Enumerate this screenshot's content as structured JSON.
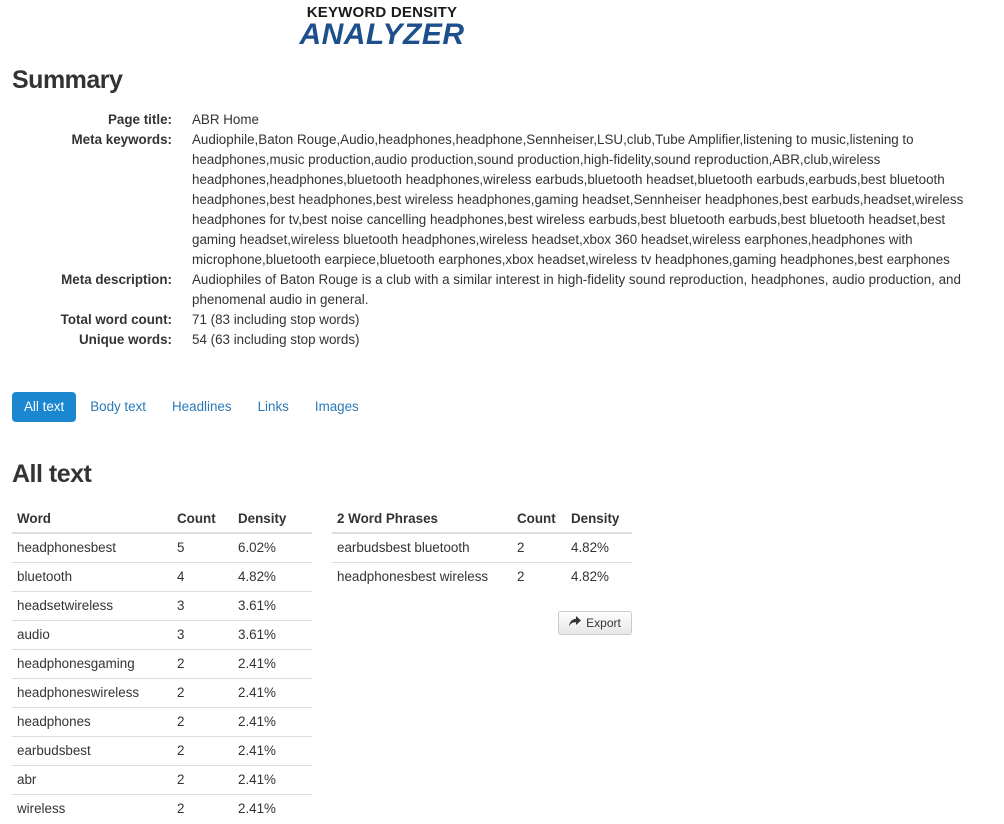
{
  "logo": {
    "line1": "KEYWORD DENSITY",
    "line2": "ANALYZER",
    "color": "#1d4f8c"
  },
  "summary": {
    "heading": "Summary",
    "rows": [
      {
        "label": "Page title:",
        "value": "ABR Home"
      },
      {
        "label": "Meta keywords:",
        "value": "Audiophile,Baton Rouge,Audio,headphones,headphone,Sennheiser,LSU,club,Tube Amplifier,listening to music,listening to headphones,music production,audio production,sound production,high-fidelity,sound reproduction,ABR,club,wireless headphones,headphones,bluetooth headphones,wireless earbuds,bluetooth headset,bluetooth earbuds,earbuds,best bluetooth headphones,best headphones,best wireless headphones,gaming headset,Sennheiser headphones,best earbuds,headset,wireless headphones for tv,best noise cancelling headphones,best wireless earbuds,best bluetooth earbuds,best bluetooth headset,best gaming headset,wireless bluetooth headphones,wireless headset,xbox 360 headset,wireless earphones,headphones with microphone,bluetooth earpiece,bluetooth earphones,xbox headset,wireless tv headphones,gaming headphones,best earphones"
      },
      {
        "label": "Meta description:",
        "value": "Audiophiles of Baton Rouge is a club with a similar interest in high-fidelity sound reproduction, headphones, audio production, and phenomenal audio in general."
      },
      {
        "label": "Total word count:",
        "value": "71 (83 including stop words)"
      },
      {
        "label": "Unique words:",
        "value": "54 (63 including stop words)"
      }
    ]
  },
  "tabs": [
    {
      "label": "All text",
      "active": true
    },
    {
      "label": "Body text",
      "active": false
    },
    {
      "label": "Headlines",
      "active": false
    },
    {
      "label": "Links",
      "active": false
    },
    {
      "label": "Images",
      "active": false
    }
  ],
  "section": {
    "heading": "All text"
  },
  "word_table": {
    "headers": [
      "Word",
      "Count",
      "Density"
    ],
    "rows": [
      [
        "headphonesbest",
        "5",
        "6.02%"
      ],
      [
        "bluetooth",
        "4",
        "4.82%"
      ],
      [
        "headsetwireless",
        "3",
        "3.61%"
      ],
      [
        "audio",
        "3",
        "3.61%"
      ],
      [
        "headphonesgaming",
        "2",
        "2.41%"
      ],
      [
        "headphoneswireless",
        "2",
        "2.41%"
      ],
      [
        "headphones",
        "2",
        "2.41%"
      ],
      [
        "earbudsbest",
        "2",
        "2.41%"
      ],
      [
        "abr",
        "2",
        "2.41%"
      ],
      [
        "wireless",
        "2",
        "2.41%"
      ]
    ]
  },
  "phrase_table": {
    "headers": [
      "2 Word Phrases",
      "Count",
      "Density"
    ],
    "rows": [
      [
        "earbudsbest bluetooth",
        "2",
        "4.82%"
      ],
      [
        "headphonesbest wireless",
        "2",
        "4.82%"
      ]
    ]
  },
  "export": {
    "label": "Export",
    "icon": "share-arrow-icon"
  },
  "colors": {
    "accent": "#1a87d0",
    "link": "#2a7ab8",
    "border": "#dddddd"
  }
}
